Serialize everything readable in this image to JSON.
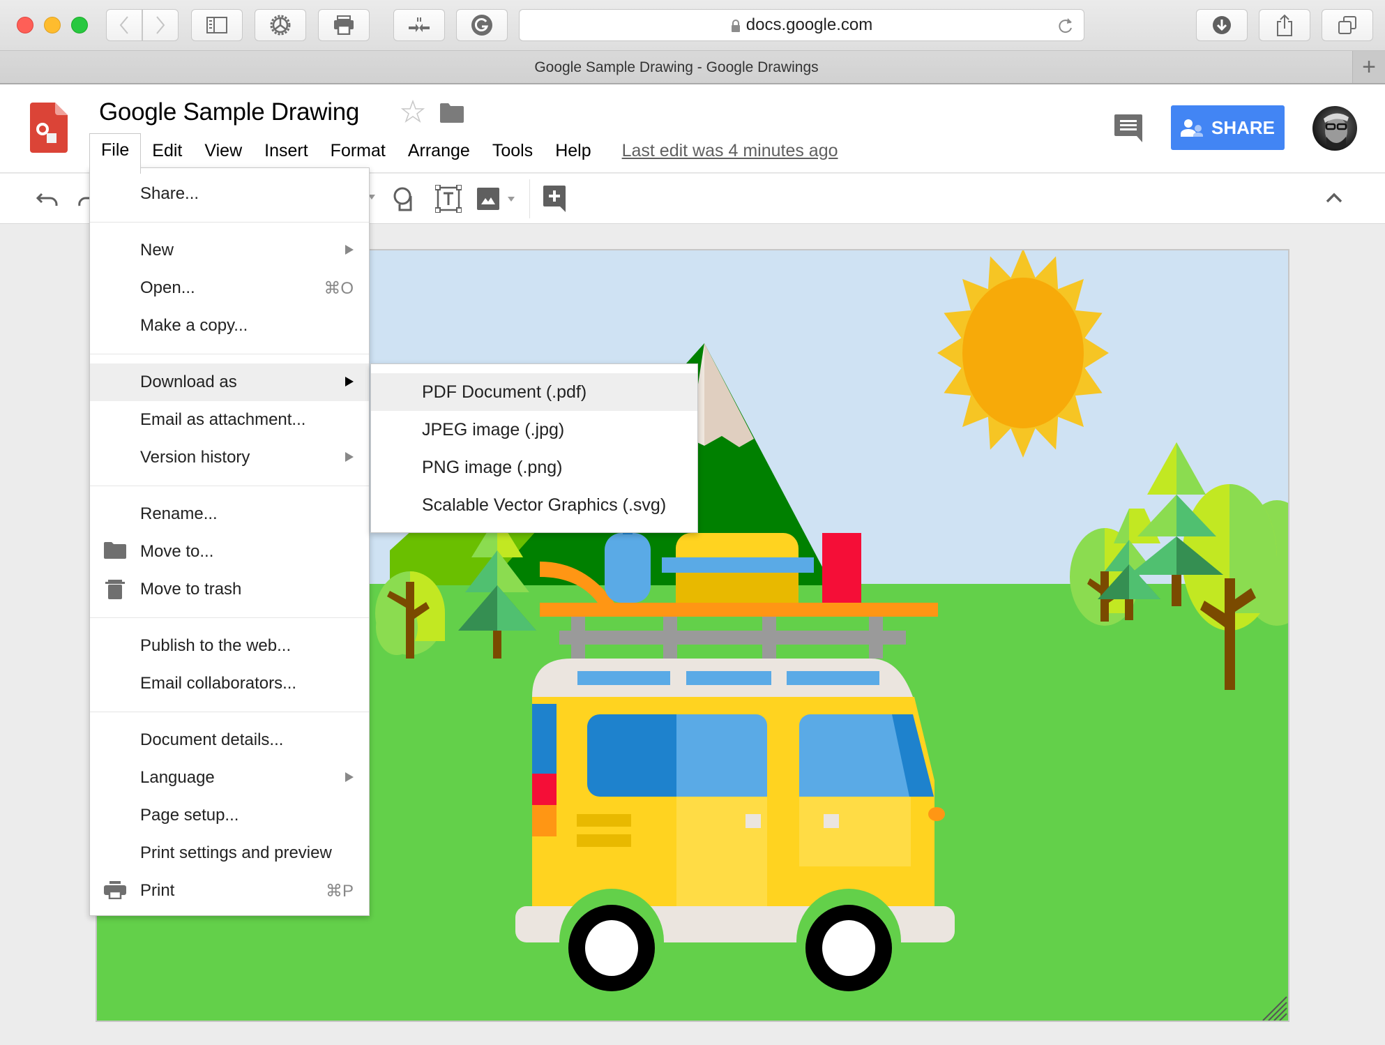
{
  "browser": {
    "url": "docs.google.com",
    "tab_title": "Google Sample Drawing - Google Drawings",
    "new_tab_label": "+",
    "buttons": [
      "back",
      "forward",
      "sidebar",
      "extension-gear",
      "print",
      "extension-arrows",
      "grammarly",
      "reload",
      "downloads",
      "share",
      "tabs-overview"
    ]
  },
  "header": {
    "app": "Google Drawings",
    "doc_title": "Google Sample Drawing",
    "menus": [
      "File",
      "Edit",
      "View",
      "Insert",
      "Format",
      "Arrange",
      "Tools",
      "Help"
    ],
    "active_menu": "File",
    "last_edit": "Last edit was 4 minutes ago",
    "share_label": "SHARE",
    "colors": {
      "share_bg": "#4285f4",
      "logo_red": "#db4437"
    }
  },
  "toolbar": {
    "icons": [
      "undo-icon",
      "redo-icon",
      "shape-icon",
      "text-box-icon",
      "image-icon",
      "comment-add-icon",
      "collapse-chevron-icon"
    ]
  },
  "file_menu": {
    "groups": [
      [
        {
          "label": "Share..."
        }
      ],
      [
        {
          "label": "New",
          "submenu": true
        },
        {
          "label": "Open...",
          "shortcut": "⌘O"
        },
        {
          "label": "Make a copy..."
        }
      ],
      [
        {
          "label": "Download as",
          "submenu": true,
          "highlighted": true
        },
        {
          "label": "Email as attachment..."
        },
        {
          "label": "Version history",
          "submenu": true
        }
      ],
      [
        {
          "label": "Rename..."
        },
        {
          "label": "Move to...",
          "icon": "folder-icon"
        },
        {
          "label": "Move to trash",
          "icon": "trash-icon"
        }
      ],
      [
        {
          "label": "Publish to the web..."
        },
        {
          "label": "Email collaborators..."
        }
      ],
      [
        {
          "label": "Document details..."
        },
        {
          "label": "Language",
          "submenu": true
        },
        {
          "label": "Page setup..."
        },
        {
          "label": "Print settings and preview"
        },
        {
          "label": "Print",
          "icon": "print-icon",
          "shortcut": "⌘P"
        }
      ]
    ]
  },
  "download_submenu": {
    "items": [
      {
        "label": "PDF Document (.pdf)",
        "highlighted": true
      },
      {
        "label": "JPEG image (.jpg)"
      },
      {
        "label": "PNG image (.png)"
      },
      {
        "label": "Scalable Vector Graphics (.svg)"
      }
    ]
  },
  "canvas": {
    "description": "Flat illustration: yellow camper van with roof rack and luggage, green mountain, sun, pine trees on grass",
    "colors": {
      "sky": "#cfe2f3",
      "grass": "#63d04a",
      "sun_outer": "#f6c524",
      "sun_inner": "#f7aa09",
      "mountain": "#008000",
      "snow": "#e0cfc0",
      "van_body": "#ffd320",
      "van_roof": "#ebe5df",
      "window_light": "#5aaae6",
      "window_dark": "#1e82cd",
      "rack": "#9a9a9a",
      "board": "#ff9614",
      "luggage_red": "#f50e37",
      "trunk": "#7a4a00"
    }
  }
}
